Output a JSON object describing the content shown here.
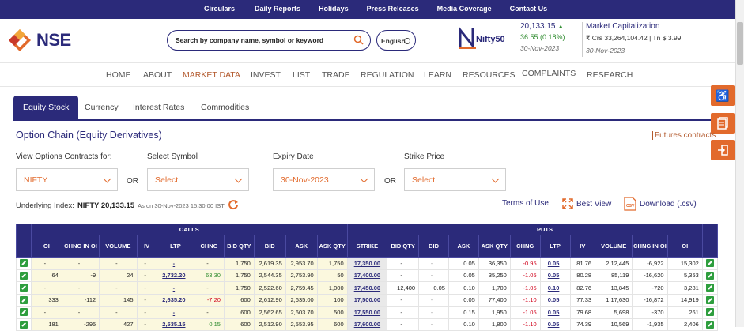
{
  "topbar": {
    "links": [
      "Circulars",
      "Daily Reports",
      "Holidays",
      "Press Releases",
      "Media Coverage",
      "Contact Us"
    ]
  },
  "brand": {
    "logo_text": "NSE",
    "accent": "#e26a2c",
    "primary": "#2b2a7a"
  },
  "search": {
    "placeholder": "Search by company name, symbol or keyword"
  },
  "language": {
    "selected": "English"
  },
  "nifty": {
    "label": "Nifty50",
    "value": "20,133.15",
    "change": "36.55 (0.18%)",
    "date": "30-Nov-2023"
  },
  "market_cap": {
    "title": "Market Capitalization",
    "value": "₹ Crs 33,264,104.42 | Tn $ 3.99",
    "date": "30-Nov-2023"
  },
  "nav": {
    "items": [
      "HOME",
      "ABOUT",
      "MARKET DATA",
      "INVEST",
      "LIST",
      "TRADE",
      "REGULATION",
      "LEARN",
      "RESOURCES",
      "COMPLAINTS",
      "RESEARCH"
    ],
    "active": "MARKET DATA"
  },
  "tabs": [
    "Equity Stock",
    "Currency",
    "Interest Rates",
    "Commodities"
  ],
  "page": {
    "title": "Option Chain (Equity Derivatives)",
    "futures_link": "Futures contracts"
  },
  "filters": {
    "view_label": "View Options Contracts for:",
    "view_value": "NIFTY",
    "symbol_label": "Select Symbol",
    "symbol_value": "Select",
    "expiry_label": "Expiry Date",
    "expiry_value": "30-Nov-2023",
    "strike_label": "Strike Price",
    "strike_value": "Select",
    "or1": "OR",
    "or2": "OR"
  },
  "underlying": {
    "label": "Underlying Index:",
    "value": "NIFTY 20,133.15",
    "as_of": "As on 30-Nov-2023 15:30:00 IST"
  },
  "actions": {
    "terms": "Terms of Use",
    "best_view": "Best View",
    "download": "Download (.csv)"
  },
  "table": {
    "calls_label": "CALLS",
    "puts_label": "PUTS",
    "headers": [
      "OI",
      "CHNG IN OI",
      "VOLUME",
      "IV",
      "LTP",
      "CHNG",
      "BID QTY",
      "BID",
      "ASK",
      "ASK QTY",
      "STRIKE",
      "BID QTY",
      "BID",
      "ASK",
      "ASK QTY",
      "CHNG",
      "LTP",
      "IV",
      "VOLUME",
      "CHNG IN OI",
      "OI"
    ],
    "rows": [
      [
        "-",
        "-",
        "-",
        "-",
        "-",
        "-",
        "1,750",
        "2,619.35",
        "2,953.70",
        "1,750",
        "17,350.00",
        "-",
        "-",
        "0.05",
        "36,350",
        "-0.95",
        "0.05",
        "81.76",
        "2,12,445",
        "-6,922",
        "15,302"
      ],
      [
        "64",
        "-9",
        "24",
        "-",
        "2,732.20",
        "63.30",
        "1,750",
        "2,544.35",
        "2,753.90",
        "50",
        "17,400.00",
        "-",
        "-",
        "0.05",
        "35,250",
        "-1.05",
        "0.05",
        "80.28",
        "85,119",
        "-16,620",
        "5,353"
      ],
      [
        "-",
        "-",
        "-",
        "-",
        "-",
        "-",
        "1,750",
        "2,522.60",
        "2,759.45",
        "1,000",
        "17,450.00",
        "12,400",
        "0.05",
        "0.10",
        "1,700",
        "-1.05",
        "0.10",
        "82.76",
        "13,845",
        "-720",
        "3,281"
      ],
      [
        "333",
        "-112",
        "145",
        "-",
        "2,635.20",
        "-7.20",
        "600",
        "2,612.90",
        "2,635.00",
        "100",
        "17,500.00",
        "-",
        "-",
        "0.05",
        "77,400",
        "-1.10",
        "0.05",
        "77.33",
        "1,17,630",
        "-16,872",
        "14,919"
      ],
      [
        "-",
        "-",
        "-",
        "-",
        "-",
        "-",
        "600",
        "2,562.65",
        "2,603.70",
        "500",
        "17,550.00",
        "-",
        "-",
        "0.15",
        "1,950",
        "-1.05",
        "0.05",
        "79.68",
        "5,698",
        "-370",
        "261"
      ],
      [
        "181",
        "-295",
        "427",
        "-",
        "2,535.15",
        "0.15",
        "600",
        "2,512.90",
        "2,553.95",
        "600",
        "17,600.00",
        "-",
        "-",
        "0.10",
        "1,800",
        "-1.10",
        "0.05",
        "74.39",
        "10,569",
        "-1,935",
        "2,406"
      ]
    ]
  }
}
